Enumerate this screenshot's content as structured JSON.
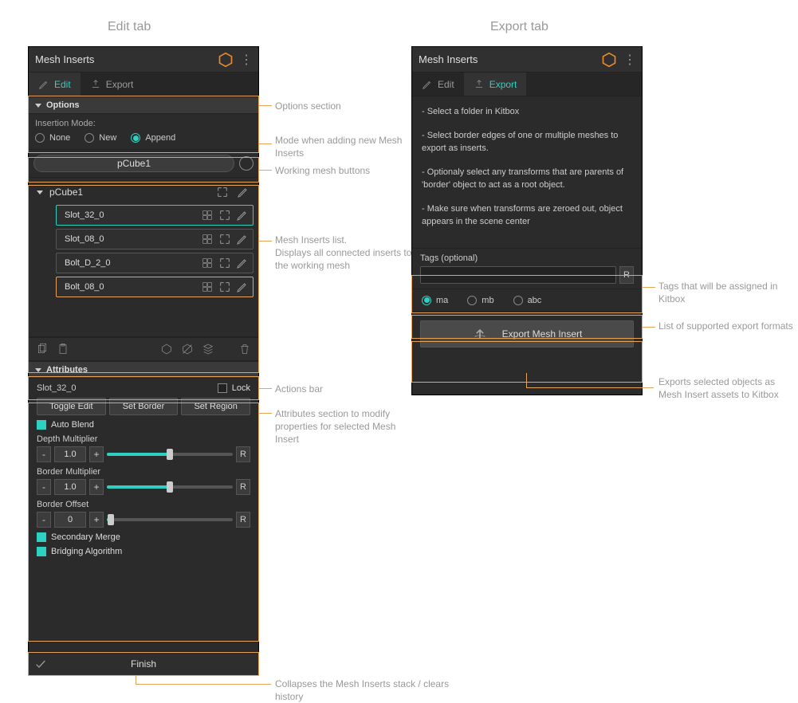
{
  "headings": {
    "edit": "Edit tab",
    "export": "Export tab"
  },
  "panel": {
    "title": "Mesh Inserts"
  },
  "tabs": {
    "edit": "Edit",
    "export": "Export"
  },
  "options": {
    "header": "Options",
    "insertion_mode_label": "Insertion Mode:",
    "modes": {
      "none": "None",
      "new": "New",
      "append": "Append"
    }
  },
  "working": {
    "mesh_name": "pCube1"
  },
  "list": {
    "group": "pCube1",
    "items": [
      {
        "label": "Slot_32_0",
        "highlight": "teal"
      },
      {
        "label": "Slot_08_0",
        "highlight": "none"
      },
      {
        "label": "Bolt_D_2_0",
        "highlight": "none"
      },
      {
        "label": "Bolt_08_0",
        "highlight": "orange"
      }
    ]
  },
  "attributes": {
    "header": "Attributes",
    "selected": "Slot_32_0",
    "lock_label": "Lock",
    "buttons": {
      "toggle_edit": "Toggle Edit",
      "set_border": "Set Border",
      "set_region": "Set Region"
    },
    "auto_blend": "Auto Blend",
    "sliders": {
      "depth_mult": {
        "label": "Depth Multiplier",
        "value": "1.0",
        "fill_pct": 50
      },
      "border_mult": {
        "label": "Border Multiplier",
        "value": "1.0",
        "fill_pct": 50
      },
      "border_offset": {
        "label": "Border Offset",
        "value": "0",
        "fill_pct": 3
      }
    },
    "secondary_merge": "Secondary Merge",
    "bridging_algo": "Bridging Algorithm"
  },
  "finish": {
    "label": "Finish"
  },
  "export": {
    "instructions": [
      "- Select a folder in Kitbox",
      "- Select border edges of one or multiple meshes to export as inserts.",
      "- Optionaly select any transforms that are parents of 'border' object to act as a root object.",
      "- Make sure when transforms are zeroed out, object appears in the scene center"
    ],
    "tags_label": "Tags (optional)",
    "formats": {
      "ma": "ma",
      "mb": "mb",
      "abc": "abc"
    },
    "export_btn": "Export Mesh Insert"
  },
  "callouts": {
    "options_section": "Options section",
    "insertion_mode": "Mode when adding new Mesh Inserts",
    "working_mesh": "Working mesh buttons",
    "inserts_list": "Mesh Inserts list.\nDisplays all connected inserts to the working mesh",
    "actions_bar": "Actions bar",
    "attributes": "Attributes section to modify properties for selected Mesh Insert",
    "finish": "Collapses the Mesh Inserts stack / clears history",
    "tags": "Tags that will be assigned in Kitbox",
    "formats": "List of supported export formats",
    "export_btn": "Exports selected objects as Mesh Insert assets to Kitbox"
  },
  "glyphs": {
    "reset": "R",
    "minus": "-",
    "plus": "+"
  }
}
